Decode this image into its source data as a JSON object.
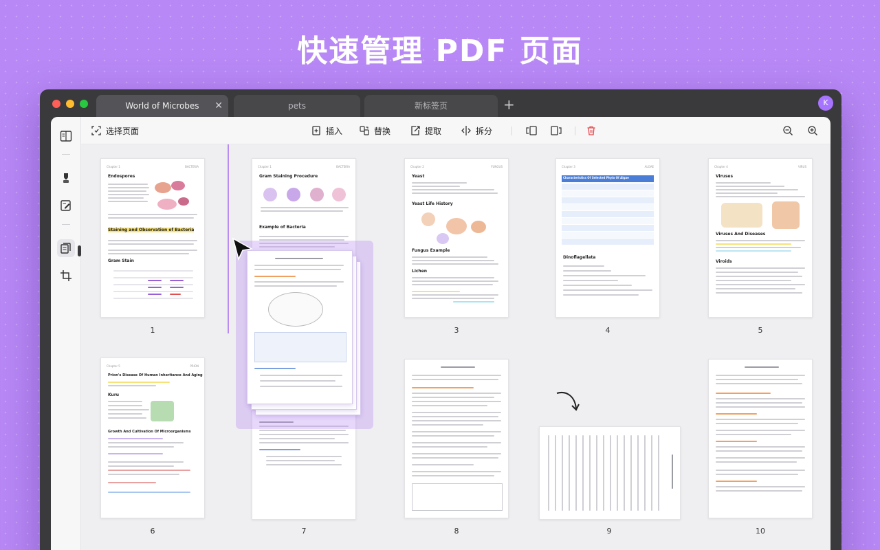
{
  "hero": {
    "title": "快速管理 PDF 页面"
  },
  "window": {
    "tabs": [
      {
        "label": "World of Microbes",
        "active": true
      },
      {
        "label": "pets",
        "active": false
      },
      {
        "label": "新标签页",
        "active": false
      }
    ],
    "avatar_initial": "K"
  },
  "toolbar": {
    "select_pages": "选择页面",
    "insert": "插入",
    "replace": "替换",
    "extract": "提取",
    "split": "拆分"
  },
  "sidebar": {
    "items": [
      {
        "icon": "reader-icon"
      },
      {
        "icon": "highlighter-icon"
      },
      {
        "icon": "edit-icon"
      },
      {
        "icon": "organize-pages-icon",
        "active": true
      },
      {
        "icon": "crop-icon"
      }
    ]
  },
  "pages": [
    {
      "number": "1",
      "title": "Endospores",
      "subtitle": "Staining and Observation of Bacteria",
      "section": "Gram Stain"
    },
    {
      "number": "2",
      "title": "Gram Staining Procedure",
      "subtitle": "Example of Bacteria"
    },
    {
      "number": "3",
      "title": "Yeast",
      "subtitle": "Yeast Life History",
      "section": "Fungus Example",
      "extra": "Lichen"
    },
    {
      "number": "4",
      "title": "Characteristics Of Selected Phyla Of Algae",
      "subtitle": "Dinoflagellata"
    },
    {
      "number": "5",
      "title": "Viruses",
      "subtitle": "Viruses And Diseases",
      "section": "Viroids"
    },
    {
      "number": "6",
      "title": "Prion's Disease Of Human Inheritance And Aging",
      "subtitle": "Kuru",
      "section": "Growth And Cultivation Of Microorganisms"
    },
    {
      "number": "7"
    },
    {
      "number": "8"
    },
    {
      "number": "9"
    },
    {
      "number": "10"
    }
  ],
  "colors": {
    "accent": "#b98cf3",
    "background": "#b889f6",
    "delete": "#e5484d"
  }
}
